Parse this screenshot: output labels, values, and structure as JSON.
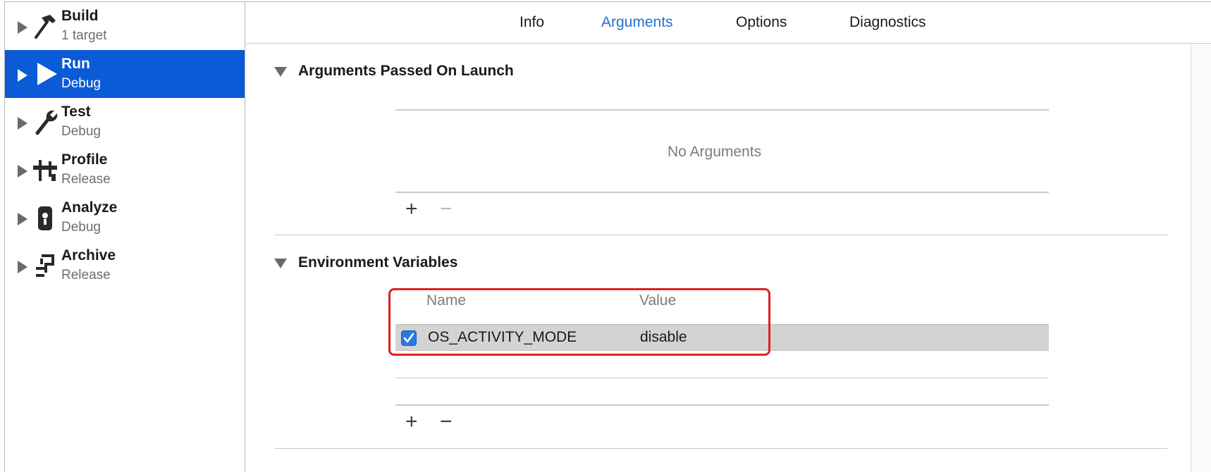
{
  "sidebar": {
    "items": [
      {
        "title": "Build",
        "subtitle": "1 target",
        "icon": "hammer-icon",
        "selected": false
      },
      {
        "title": "Run",
        "subtitle": "Debug",
        "icon": "play-icon",
        "selected": true
      },
      {
        "title": "Test",
        "subtitle": "Debug",
        "icon": "wrench-icon",
        "selected": false
      },
      {
        "title": "Profile",
        "subtitle": "Release",
        "icon": "caliper-icon",
        "selected": false
      },
      {
        "title": "Analyze",
        "subtitle": "Debug",
        "icon": "analyze-icon",
        "selected": false
      },
      {
        "title": "Archive",
        "subtitle": "Release",
        "icon": "archive-icon",
        "selected": false
      }
    ]
  },
  "tabs": [
    {
      "label": "Info",
      "active": false
    },
    {
      "label": "Arguments",
      "active": true
    },
    {
      "label": "Options",
      "active": false
    },
    {
      "label": "Diagnostics",
      "active": false
    }
  ],
  "arguments_section": {
    "title": "Arguments Passed On Launch",
    "empty_text": "No Arguments",
    "add": "+",
    "remove": "−"
  },
  "env_section": {
    "title": "Environment Variables",
    "columns": {
      "name": "Name",
      "value": "Value"
    },
    "rows": [
      {
        "checked": true,
        "name": "OS_ACTIVITY_MODE",
        "value": "disable"
      }
    ],
    "add": "+",
    "remove": "−"
  },
  "colors": {
    "selection": "#0b5ad6",
    "active_tab": "#2270c9",
    "highlight_box": "#e02020",
    "checkbox": "#2a78e4"
  }
}
